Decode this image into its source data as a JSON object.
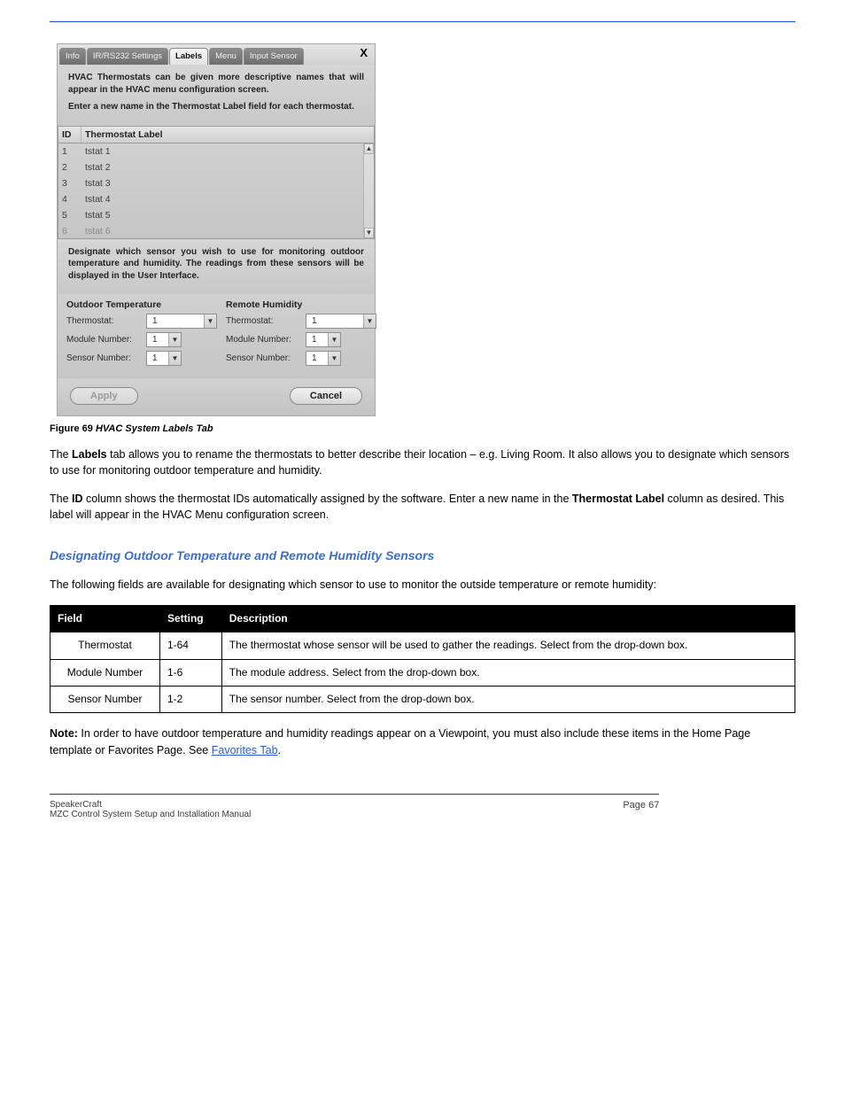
{
  "dialog": {
    "tabs": {
      "info": "Info",
      "ir": "IR/RS232 Settings",
      "labels": "Labels",
      "menu": "Menu",
      "input": "Input Sensor"
    },
    "close": "X",
    "helpTop1": "HVAC Thermostats can be given more descriptive names that will appear in the HVAC menu configuration screen.",
    "helpTop2": "Enter a new name in the Thermostat Label field for each thermostat.",
    "cols": {
      "id": "ID",
      "label": "Thermostat Label"
    },
    "rows": [
      {
        "id": "1",
        "label": "tstat 1"
      },
      {
        "id": "2",
        "label": "tstat 2"
      },
      {
        "id": "3",
        "label": "tstat 3"
      },
      {
        "id": "4",
        "label": "tstat 4"
      },
      {
        "id": "5",
        "label": "tstat 5"
      },
      {
        "id": "6",
        "label": "tstat 6"
      }
    ],
    "helpMid": "Designate which sensor you wish to use for monitoring outdoor temperature and humidity.  The readings from these sensors will be displayed in the User Interface.",
    "outTemp": {
      "heading": "Outdoor Temperature",
      "thermoLabel": "Thermostat:",
      "thermoVal": "1",
      "modLabel": "Module Number:",
      "modVal": "1",
      "sensLabel": "Sensor Number:",
      "sensVal": "1"
    },
    "remHum": {
      "heading": "Remote Humidity",
      "thermoLabel": "Thermostat:",
      "thermoVal": "1",
      "modLabel": "Module Number:",
      "modVal": "1",
      "sensLabel": "Sensor Number:",
      "sensVal": "1"
    },
    "apply": "Apply",
    "cancel": "Cancel"
  },
  "caption": {
    "fig": "Figure 69 ",
    "title": "HVAC System Labels Tab"
  },
  "para": {
    "p1a": "The ",
    "p1b": "Labels",
    "p1c": " tab allows you to rename the thermostats to better describe their location – e.g. Living Room.  It also allows you to designate which sensors to use for monitoring outdoor temperature and humidity.",
    "p2a": "The ",
    "p2b": "ID",
    "p2c": " column shows the thermostat IDs automatically assigned by the software.  Enter a new name in the ",
    "p2d": "Thermostat Label",
    "p2e": " column as desired.  This label will appear in the HVAC Menu configuration screen.",
    "p3": "The following fields are available for designating which sensor to use to monitor the outside temperature or remote humidity:"
  },
  "h2": "Designating Outdoor Temperature and Remote Humidity Sensors",
  "table": {
    "h1": "Field",
    "h2": "Setting",
    "h3": "Description",
    "r1": {
      "f": "Thermostat",
      "s": "1-64",
      "d": "The thermostat whose sensor will be used to gather the readings.  Select from the drop-down box."
    },
    "r2": {
      "f": "Module Number",
      "s": "1-6",
      "d": "The module address.  Select from the drop-down box."
    },
    "r3": {
      "f": "Sensor Number",
      "s": "1-2",
      "d": "The sensor number.  Select from the drop-down box."
    }
  },
  "note": {
    "lead": "Note:",
    "body1": "  In order to have outdoor temperature and humidity readings appear on a Viewpoint, you must also include these items in the Home Page template or Favorites Page.  See ",
    "link": "Favorites Tab",
    "body2": "."
  },
  "footer": {
    "left1": "SpeakerCraft",
    "left2": "MZC Control System Setup and Installation Manual",
    "page": "Page 67"
  }
}
